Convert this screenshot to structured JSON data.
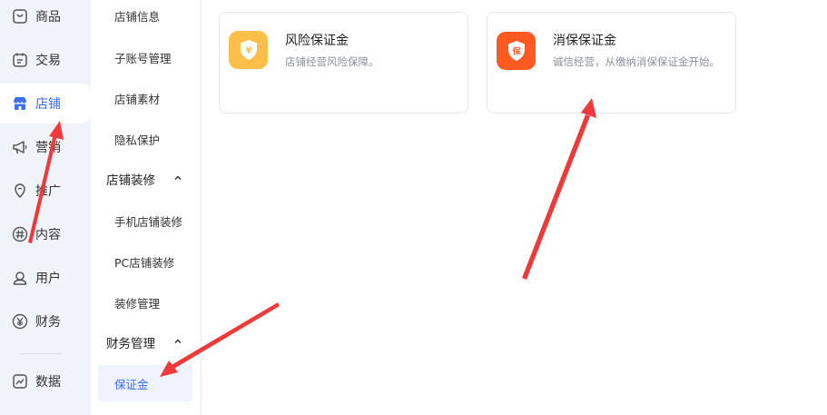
{
  "nav": {
    "items": [
      {
        "label": "商品",
        "icon": "goods-icon"
      },
      {
        "label": "交易",
        "icon": "trade-icon"
      },
      {
        "label": "店铺",
        "icon": "shop-icon",
        "active": true
      },
      {
        "label": "营销",
        "icon": "megaphone-icon"
      },
      {
        "label": "推广",
        "icon": "promotion-icon"
      },
      {
        "label": "内容",
        "icon": "hashtag-icon"
      },
      {
        "label": "用户",
        "icon": "user-icon"
      },
      {
        "label": "财务",
        "icon": "yuan-icon"
      },
      {
        "label": "数据",
        "icon": "data-chart-icon"
      }
    ]
  },
  "submenu": {
    "items": [
      "店铺信息",
      "子账号管理",
      "店铺素材",
      "隐私保护"
    ],
    "group_decoration": {
      "label": "店铺装修",
      "items": [
        "手机店铺装修",
        "PC店铺装修",
        "装修管理"
      ]
    },
    "group_finance": {
      "label": "财务管理",
      "items": [
        "保证金"
      ]
    }
  },
  "cards": [
    {
      "title": "风险保证金",
      "desc": "店铺经营风险保障。",
      "badge_glyph": "¥",
      "badge_color": "#fdbf47"
    },
    {
      "title": "消保保证金",
      "desc": "诚信经营，从缴纳消保保证金开始。",
      "badge_glyph": "保",
      "badge_color": "#ff5a1f"
    }
  ],
  "colors": {
    "accent": "#3c6ff0",
    "nav_bg": "#f0f3fa",
    "annotation": "#ee3a3a"
  }
}
